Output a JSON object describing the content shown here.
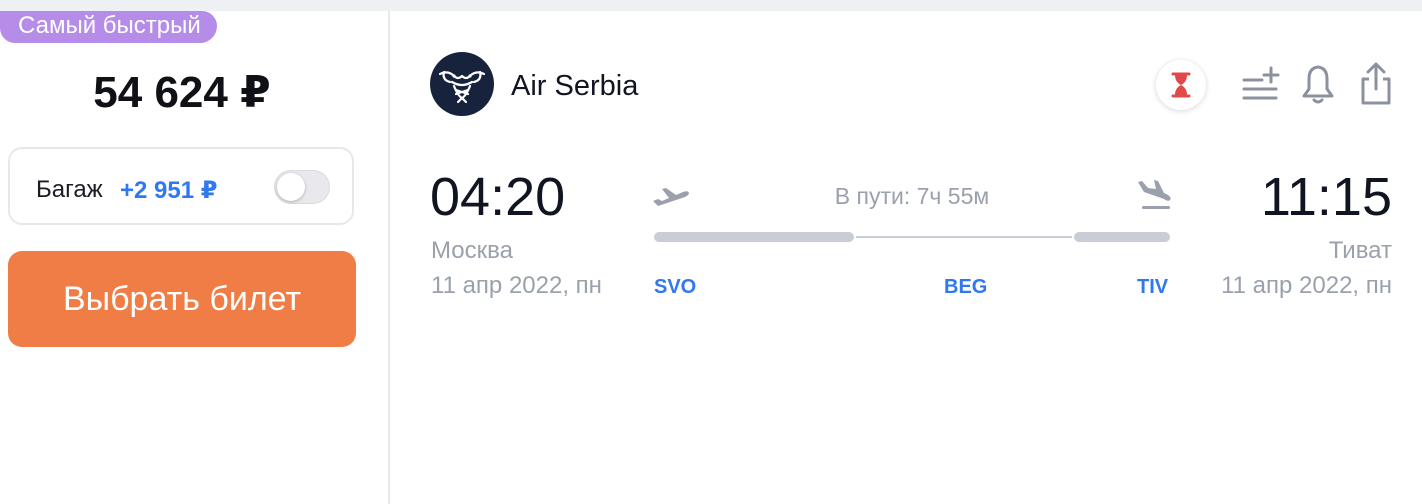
{
  "badge": {
    "label": "Самый быстрый"
  },
  "price": {
    "amount": "54 624 ₽"
  },
  "baggage": {
    "label": "Багаж",
    "price": "+2 951 ₽",
    "toggle_on": false
  },
  "select_button": {
    "label": "Выбрать билет"
  },
  "airline": {
    "name": "Air Serbia"
  },
  "actions": {
    "hourglass_icon": "hourglass-icon",
    "add_list_icon": "list-add-icon",
    "bell_icon": "bell-icon",
    "share_icon": "share-icon"
  },
  "departure": {
    "time": "04:20",
    "city": "Москва",
    "date": "11 апр 2022, пн",
    "code": "SVO"
  },
  "arrival": {
    "time": "11:15",
    "city": "Тиват",
    "date": "11 апр 2022, пн",
    "code": "TIV"
  },
  "route": {
    "duration": "В пути: 7ч 55м",
    "stop_code": "BEG"
  },
  "colors": {
    "badge": "#b58ce8",
    "button": "#ef7d45",
    "accent_blue": "#2f78f0",
    "muted_text": "#9aa1ac",
    "logo_bg": "#17233d"
  }
}
